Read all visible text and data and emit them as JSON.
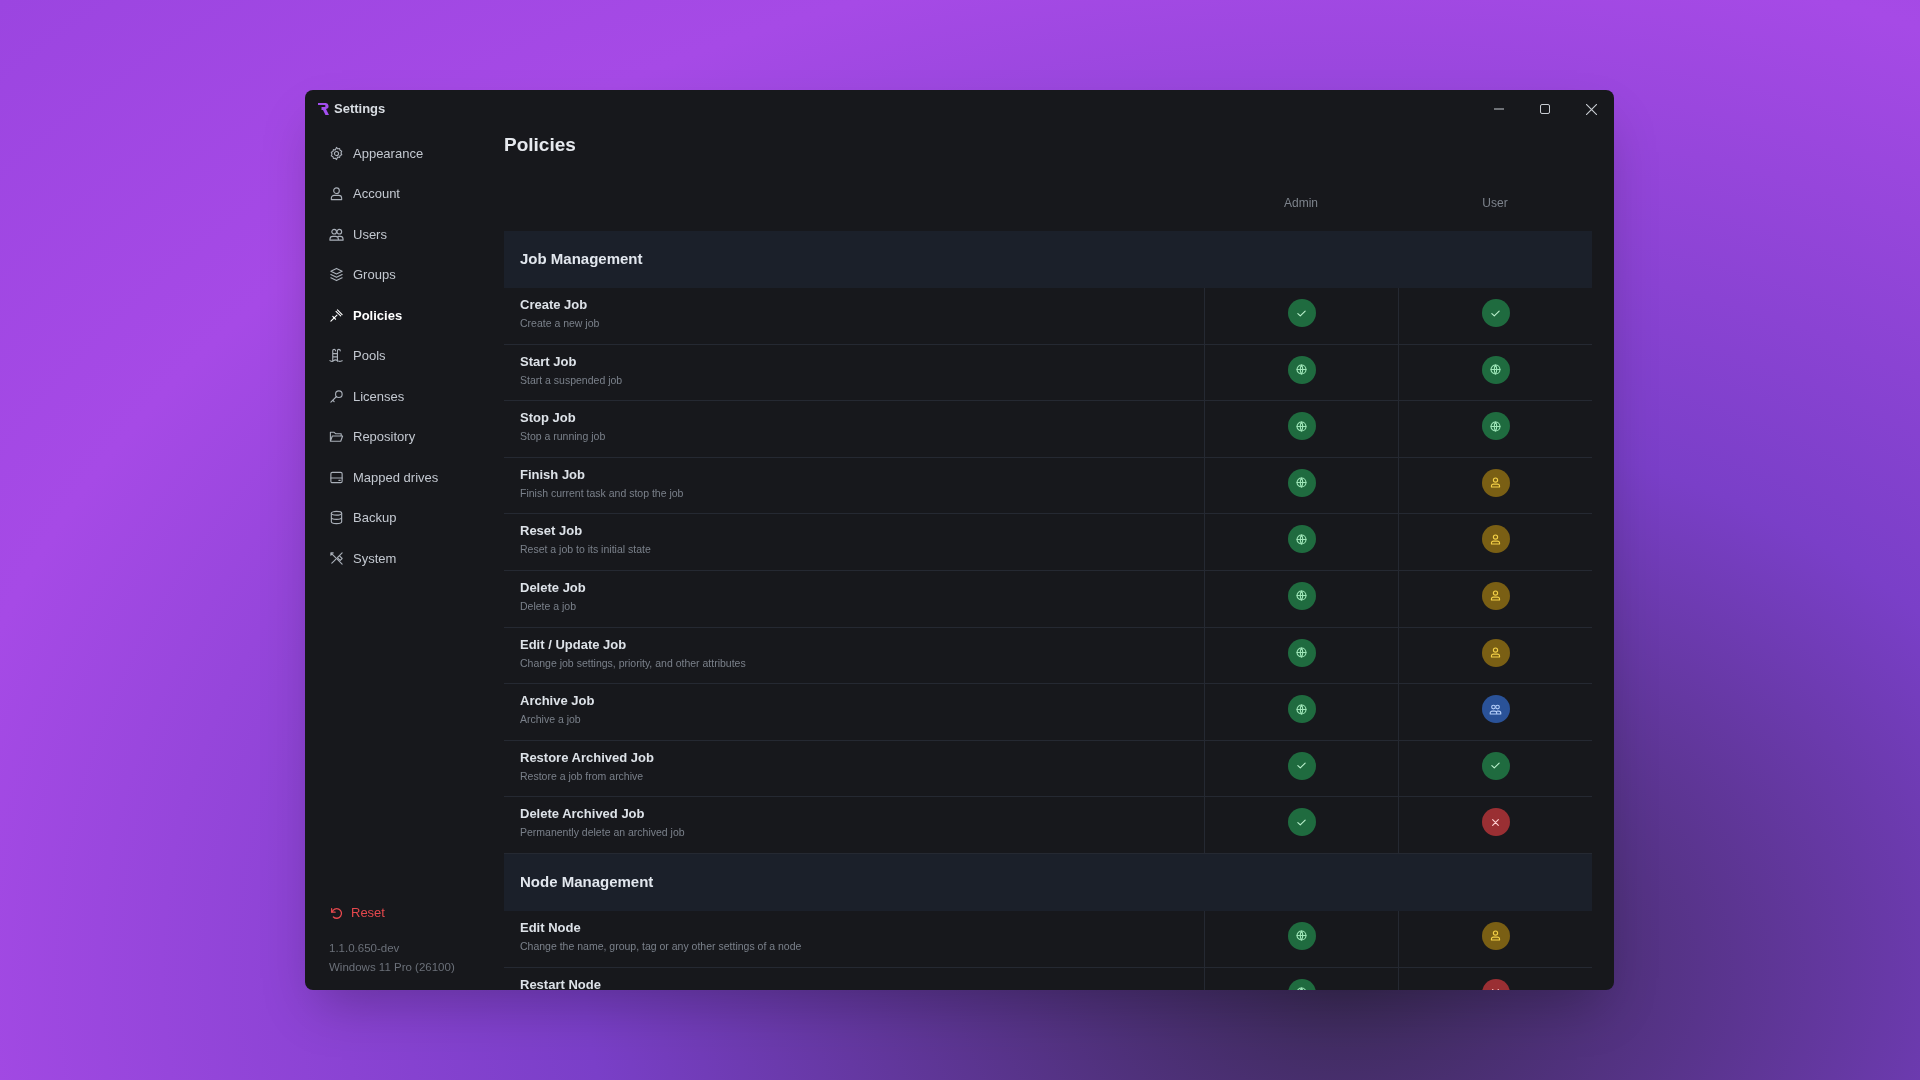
{
  "window": {
    "title": "Settings"
  },
  "sidebar": {
    "items": [
      {
        "label": "Appearance",
        "selected": false
      },
      {
        "label": "Account",
        "selected": false
      },
      {
        "label": "Users",
        "selected": false
      },
      {
        "label": "Groups",
        "selected": false
      },
      {
        "label": "Policies",
        "selected": true
      },
      {
        "label": "Pools",
        "selected": false
      },
      {
        "label": "Licenses",
        "selected": false
      },
      {
        "label": "Repository",
        "selected": false
      },
      {
        "label": "Mapped drives",
        "selected": false
      },
      {
        "label": "Backup",
        "selected": false
      },
      {
        "label": "System",
        "selected": false
      }
    ],
    "reset": "Reset",
    "version": "1.1.0.650-dev",
    "os": "Windows 11 Pro (26100)"
  },
  "page": {
    "title": "Policies"
  },
  "table": {
    "columns": [
      "Admin",
      "User"
    ],
    "sections": [
      {
        "title": "Job Management",
        "rows": [
          {
            "name": "Create Job",
            "description": "Create a new job",
            "cells": [
              {
                "kind": "allow"
              },
              {
                "kind": "allow"
              }
            ]
          },
          {
            "name": "Start Job",
            "description": "Start a suspended job",
            "cells": [
              {
                "kind": "global"
              },
              {
                "kind": "global"
              }
            ]
          },
          {
            "name": "Stop Job",
            "description": "Stop a running job",
            "cells": [
              {
                "kind": "global"
              },
              {
                "kind": "global"
              }
            ]
          },
          {
            "name": "Finish Job",
            "description": "Finish current task and stop the job",
            "cells": [
              {
                "kind": "global"
              },
              {
                "kind": "own"
              }
            ]
          },
          {
            "name": "Reset Job",
            "description": "Reset a job to its initial state",
            "cells": [
              {
                "kind": "global"
              },
              {
                "kind": "own"
              }
            ]
          },
          {
            "name": "Delete Job",
            "description": "Delete a job",
            "cells": [
              {
                "kind": "global"
              },
              {
                "kind": "own"
              }
            ]
          },
          {
            "name": "Edit / Update Job",
            "description": "Change job settings, priority, and other attributes",
            "cells": [
              {
                "kind": "global"
              },
              {
                "kind": "own"
              }
            ]
          },
          {
            "name": "Archive Job",
            "description": "Archive a job",
            "cells": [
              {
                "kind": "global"
              },
              {
                "kind": "group"
              }
            ]
          },
          {
            "name": "Restore Archived Job",
            "description": "Restore a job from archive",
            "cells": [
              {
                "kind": "allow"
              },
              {
                "kind": "allow"
              }
            ]
          },
          {
            "name": "Delete Archived Job",
            "description": "Permanently delete an archived job",
            "cells": [
              {
                "kind": "allow"
              },
              {
                "kind": "deny"
              }
            ]
          }
        ]
      },
      {
        "title": "Node Management",
        "rows": [
          {
            "name": "Edit Node",
            "description": "Change the name, group, tag or any other settings of a node",
            "cells": [
              {
                "kind": "global"
              },
              {
                "kind": "own"
              }
            ]
          },
          {
            "name": "Restart Node",
            "cells": [
              {
                "kind": "global"
              },
              {
                "kind": "deny"
              }
            ]
          }
        ]
      }
    ]
  }
}
